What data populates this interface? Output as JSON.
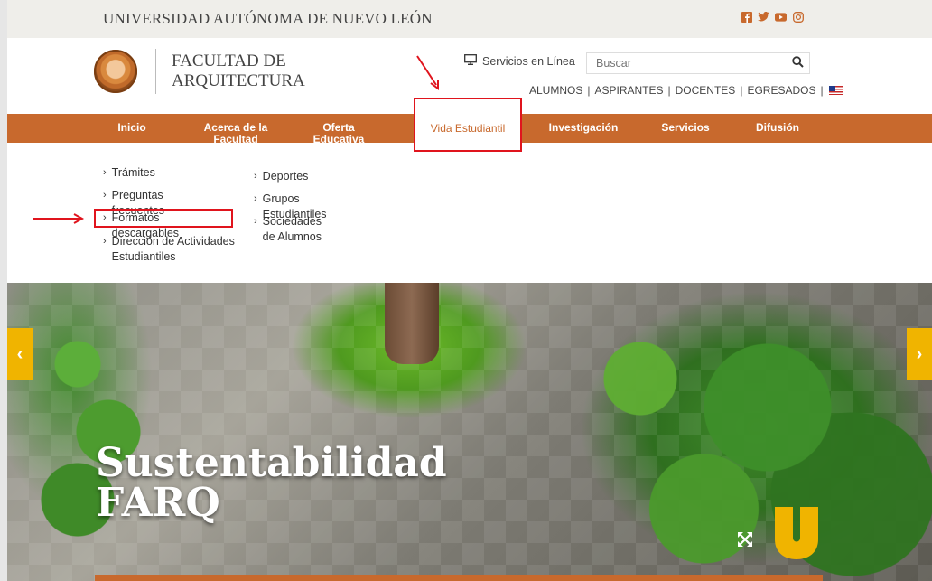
{
  "topbar": {
    "university": "UNIVERSIDAD AUTÓNOMA DE NUEVO LEÓN",
    "social": [
      {
        "icon": "facebook-icon",
        "color": "#c8692d"
      },
      {
        "icon": "twitter-icon",
        "color": "#c8692d"
      },
      {
        "icon": "youtube-icon",
        "color": "#c8692d"
      },
      {
        "icon": "instagram-icon",
        "color": "#c8692d"
      }
    ]
  },
  "header": {
    "faculty_line1": "FACULTAD DE",
    "faculty_line2": "ARQUITECTURA",
    "servicios_label": "Servicios en Línea",
    "search_placeholder": "Buscar",
    "audience": [
      "ALUMNOS",
      "ASPIRANTES",
      "DOCENTES",
      "EGRESADOS"
    ]
  },
  "nav": {
    "items": [
      {
        "label": "Inicio"
      },
      {
        "label": "Acerca de la Facultad"
      },
      {
        "label": "Oferta Educativa"
      },
      {
        "label": "Vida Estudiantil",
        "active": true
      },
      {
        "label": "Investigación"
      },
      {
        "label": "Servicios"
      },
      {
        "label": "Difusión"
      }
    ]
  },
  "dropdown": {
    "col1": [
      "Trámites",
      "Preguntas frecuentes",
      "Formatos descargables",
      "Dirección de Actividades Estudiantiles"
    ],
    "col2": [
      "Deportes",
      "Grupos Estudiantiles",
      "Sociedades de Alumnos"
    ]
  },
  "hero": {
    "title_line1": "Sustentabilidad",
    "title_line2": "FARQ"
  },
  "colors": {
    "accent": "#c8692d",
    "arrow": "#f0b400",
    "annotation": "#e0141d"
  }
}
